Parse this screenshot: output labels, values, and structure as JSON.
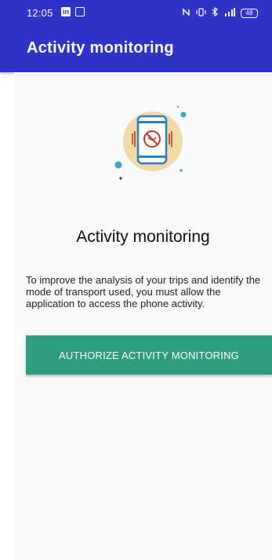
{
  "status_bar": {
    "time": "12:05",
    "linkedin_icon_label": "in",
    "battery_level": "48",
    "background_color": "#3033c8"
  },
  "app_bar": {
    "title": "Activity monitoring",
    "background_color": "#3033c8"
  },
  "main": {
    "illustration_icon": "phone-activity-blocked-icon",
    "heading": "Activity monitoring",
    "description": "To improve the analysis of your trips and identify the mode of transport used, you must allow the application to access the phone activity.",
    "authorize_button_label": "AUTHORIZE ACTIVITY MONITORING",
    "button_color": "#2e9c7f"
  }
}
